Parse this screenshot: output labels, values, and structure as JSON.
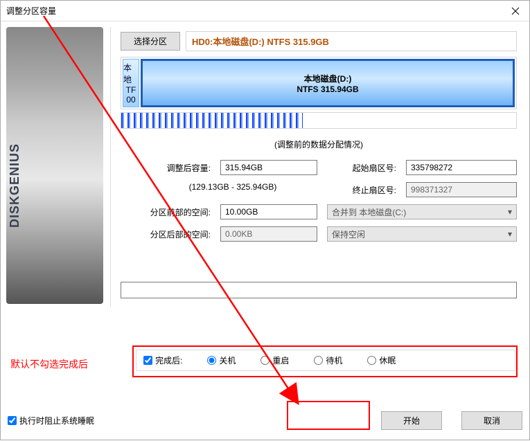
{
  "window": {
    "title": "调整分区容量"
  },
  "select_partition_btn": "选择分区",
  "partition_title": "HD0:本地磁盘(D:) NTFS 315.9GB",
  "seg_small": {
    "l1": "本地",
    "l2": "TF",
    "l3": "00"
  },
  "seg_big": {
    "name": "本地磁盘(D:)",
    "fs": "NTFS 315.94GB"
  },
  "before_caption": "(调整前的数据分配情况)",
  "fields": {
    "after_size_label": "调整后容量:",
    "after_size_value": "315.94GB",
    "start_sector_label": "起始扇区号:",
    "start_sector_value": "335798272",
    "range_hint": "(129.13GB - 325.94GB)",
    "end_sector_label": "终止扇区号:",
    "end_sector_value": "998371327",
    "space_before_label": "分区前部的空间:",
    "space_before_value": "10.00GB",
    "merge_to_label": "合并到 本地磁盘(C:)",
    "space_after_label": "分区后部的空间:",
    "space_after_value": "0.00KB",
    "keep_free_label": "保持空闲"
  },
  "options": {
    "after_complete": "完成后:",
    "shutdown": "关机",
    "restart": "重启",
    "standby": "待机",
    "hibernate": "休眠"
  },
  "red_note": "默认不勾选完成后",
  "prevent_sleep": "执行时阻止系统睡眠",
  "buttons": {
    "start": "开始",
    "cancel": "取消"
  },
  "brand": "DISKGENIUS"
}
